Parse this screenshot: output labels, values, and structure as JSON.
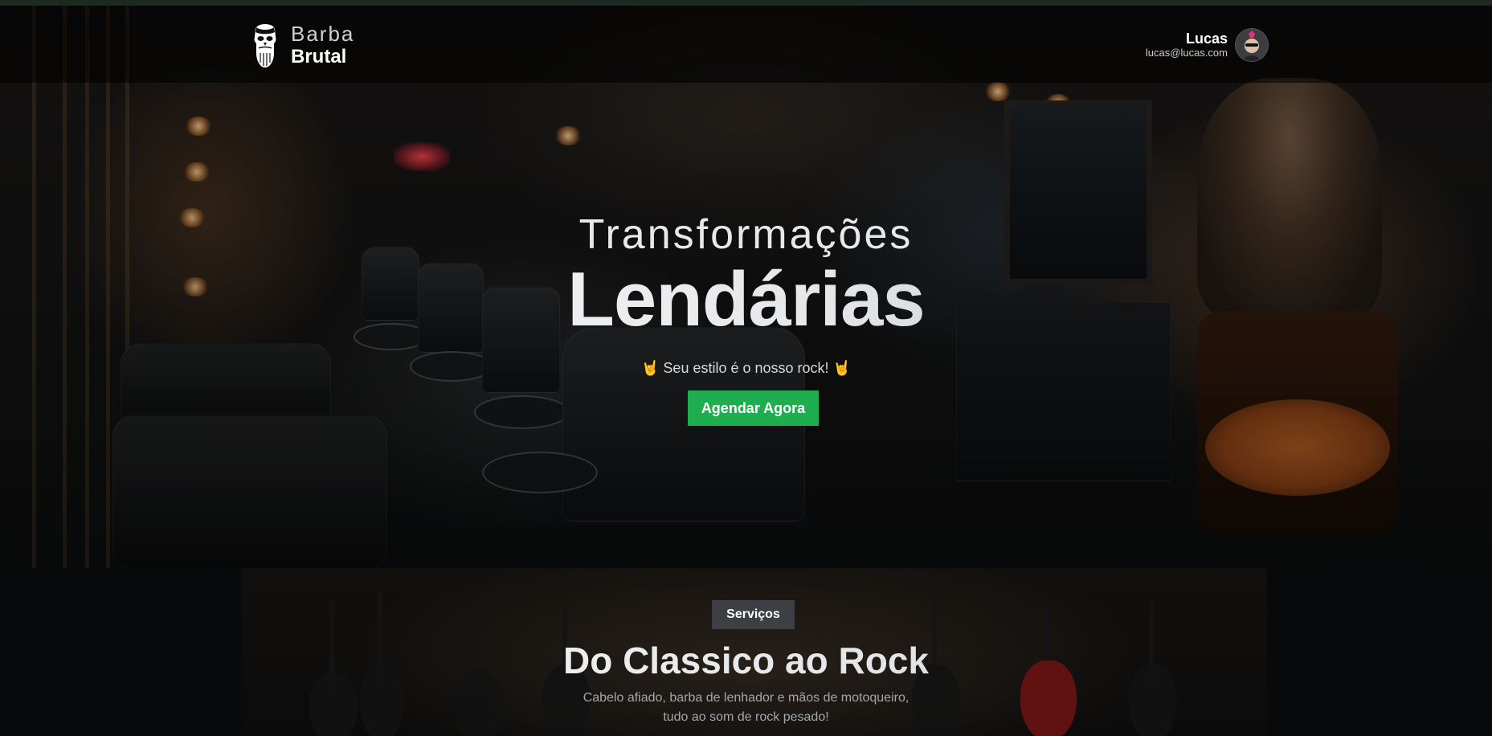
{
  "header": {
    "logo": {
      "line1": "Barba",
      "line2": "Brutal"
    },
    "user": {
      "name": "Lucas",
      "email": "lucas@lucas.com"
    }
  },
  "hero": {
    "subtitle": "Transformações",
    "title": "Lendárias",
    "tagline": "🤘 Seu estilo é o nosso rock! 🤘",
    "cta_label": "Agendar Agora"
  },
  "services": {
    "badge": "Serviços",
    "title": "Do Classico ao Rock",
    "description_line1": "Cabelo afiado, barba de lenhador e mãos de motoqueiro,",
    "description_line2": "tudo ao som de rock pesado!"
  },
  "colors": {
    "accent": "#1fae4f",
    "badge_bg": "#3d3f44",
    "background": "#07090b"
  },
  "icons": [
    "bearded-skull-logo-icon",
    "user-avatar-icon"
  ]
}
